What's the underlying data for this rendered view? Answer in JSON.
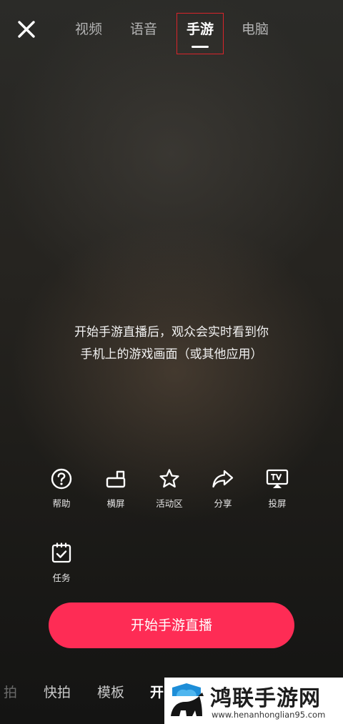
{
  "top_bar": {
    "close_icon": "close-icon",
    "tabs": [
      {
        "label": "视频",
        "active": false
      },
      {
        "label": "语音",
        "active": false
      },
      {
        "label": "手游",
        "active": true
      },
      {
        "label": "电脑",
        "active": false
      }
    ]
  },
  "hint": {
    "line1": "开始手游直播后，观众会实时看到你",
    "line2": "手机上的游戏画面（或其他应用）"
  },
  "tools": [
    {
      "label": "帮助",
      "icon": "help-icon"
    },
    {
      "label": "横屏",
      "icon": "landscape-icon"
    },
    {
      "label": "活动区",
      "icon": "star-icon"
    },
    {
      "label": "分享",
      "icon": "share-icon"
    },
    {
      "label": "投屏",
      "icon": "cast-icon"
    },
    {
      "label": "任务",
      "icon": "task-icon"
    }
  ],
  "start_button": {
    "label": "开始手游直播",
    "color": "#fe2c55"
  },
  "mode_bar": {
    "items": [
      "拍",
      "快拍",
      "模板",
      "开"
    ]
  },
  "watermark": {
    "title": "鸿联手游网",
    "url": "www.henanhonglian95.com"
  }
}
